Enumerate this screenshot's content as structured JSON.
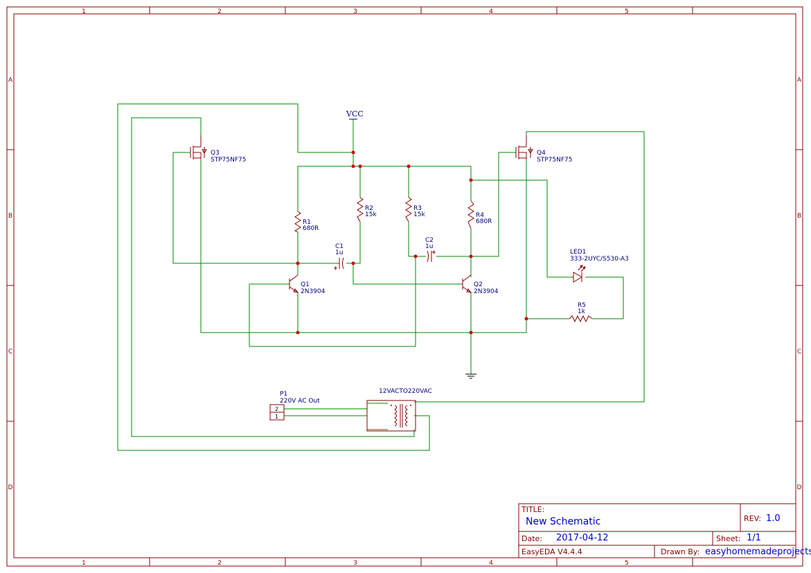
{
  "border": {
    "columns": [
      "1",
      "2",
      "3",
      "4",
      "5"
    ],
    "rows": [
      "A",
      "B",
      "C",
      "D"
    ]
  },
  "power": {
    "vcc_label": "VCC"
  },
  "components": {
    "q3": {
      "ref": "Q3",
      "value": "STP75NF75"
    },
    "q4": {
      "ref": "Q4",
      "value": "STP75NF75"
    },
    "r1": {
      "ref": "R1",
      "value": "680R"
    },
    "r2": {
      "ref": "R2",
      "value": "15k"
    },
    "r3": {
      "ref": "R3",
      "value": "15k"
    },
    "r4": {
      "ref": "R4",
      "value": "680R"
    },
    "c1": {
      "ref": "C1",
      "value": "1u"
    },
    "c2": {
      "ref": "C2",
      "value": "1u"
    },
    "q1": {
      "ref": "Q1",
      "value": "2N3904"
    },
    "q2": {
      "ref": "Q2",
      "value": "2N3904"
    },
    "led1": {
      "ref": "LED1",
      "value": "333-2UYC/S530-A3"
    },
    "r5": {
      "ref": "R5",
      "value": "1k"
    },
    "p1": {
      "ref": "P1",
      "value": "220V AC Out",
      "pins": [
        "2",
        "1"
      ]
    },
    "t1": {
      "value": "12VACTO220VAC"
    }
  },
  "title_block": {
    "title_label": "TITLE:",
    "title": "New Schematic",
    "rev_label": "REV:",
    "rev": "1.0",
    "date_label": "Date:",
    "date": "2017-04-12",
    "sheet_label": "Sheet:",
    "sheet": "1/1",
    "software": "EasyEDA V4.4.4",
    "drawn_by_label": "Drawn By:",
    "drawn_by": "easyhomemadeprojects"
  },
  "colors": {
    "frame": "#880000",
    "wire": "#008800",
    "junction": "#cc0000",
    "label_text": "#000080",
    "title_text": "#0000cc"
  }
}
